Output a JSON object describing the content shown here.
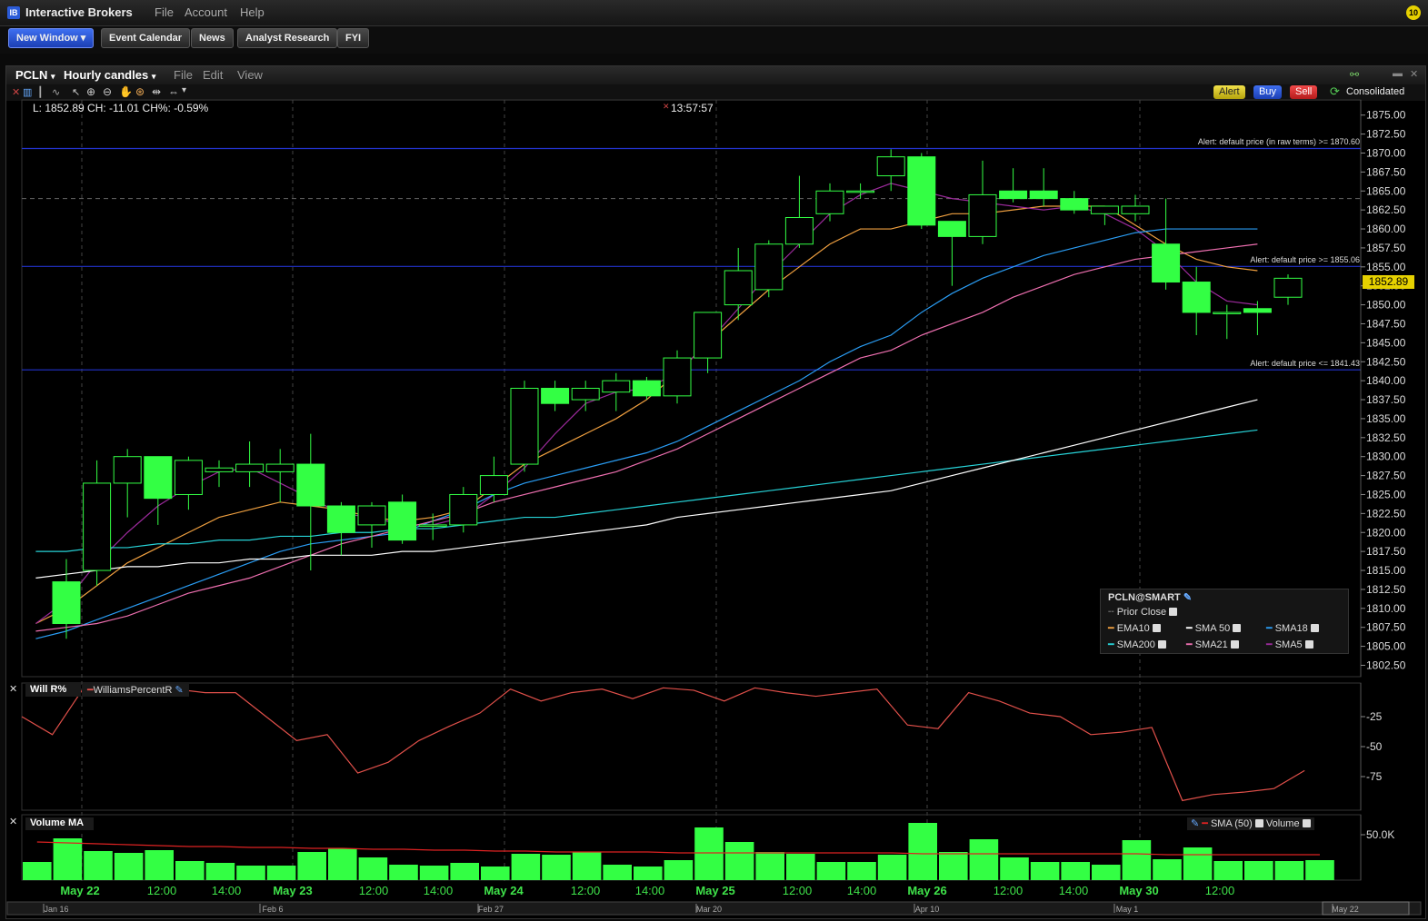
{
  "app": {
    "title": "Interactive Brokers",
    "menu": [
      "File",
      "Account",
      "Help"
    ],
    "badge": "10"
  },
  "toolbar": {
    "new_window": "New Window",
    "buttons": [
      "Event Calendar",
      "News",
      "Analyst Research",
      "FYI"
    ]
  },
  "chart_window": {
    "symbol": "PCLN",
    "interval": "Hourly candles",
    "menu": [
      "File",
      "Edit",
      "View"
    ],
    "actions": {
      "alert": "Alert",
      "buy": "Buy",
      "sell": "Sell",
      "consolidated": "Consolidated"
    },
    "info_line": "L: 1852.89 CH: -11.01 CH%: -0.59%",
    "cursor_time": "13:57:57",
    "last_price": "1852.89"
  },
  "alerts": [
    {
      "text": "Alert: default price (in raw terms) >= 1870.60",
      "price": 1870.6
    },
    {
      "text": "Alert: default price >= 1855.06",
      "price": 1855.06
    },
    {
      "text": "Alert: default price <= 1841.43",
      "price": 1841.43
    }
  ],
  "legend": {
    "title": "PCLN@SMART",
    "items": [
      {
        "name": "Prior Close",
        "color": "#888888"
      },
      {
        "name": "EMA10",
        "color": "#f0a040"
      },
      {
        "name": "SMA 50",
        "color": "#ffffff"
      },
      {
        "name": "SMA18",
        "color": "#2a9df4"
      },
      {
        "name": "SMA200",
        "color": "#27d3d8"
      },
      {
        "name": "SMA21",
        "color": "#ee6fb0"
      },
      {
        "name": "SMA5",
        "color": "#9b2a9b"
      }
    ]
  },
  "will_panel": {
    "title": "Will R%",
    "indicator": "WilliamsPercentR",
    "y_ticks": [
      "-25",
      "-50",
      "-75"
    ]
  },
  "volume_panel": {
    "title": "Volume MA",
    "sma_label": "SMA (50)",
    "volume_label": "Volume",
    "y_tick": "50.0K"
  },
  "x_axis_labels": [
    "May 22",
    "12:00",
    "14:00",
    "May 23",
    "12:00",
    "14:00",
    "May 24",
    "12:00",
    "14:00",
    "May 25",
    "12:00",
    "14:00",
    "May 26",
    "12:00",
    "14:00",
    "May 30",
    "12:00"
  ],
  "nav_labels": [
    "Jan 16",
    "Feb 6",
    "Feb 27",
    "Mar 20",
    "Apr 10",
    "May 1",
    "May 22"
  ],
  "colors": {
    "up": "#33ff44",
    "down": "#33ff44",
    "bg": "#000000",
    "grid": "#444444",
    "alert": "#2233cc",
    "will": "#e0504a",
    "vol_sma": "#dd2222"
  },
  "chart_data": {
    "type": "candlestick",
    "ylim": [
      1801,
      1877
    ],
    "y_ticks": [
      1802.5,
      1805,
      1807.5,
      1810,
      1812.5,
      1815,
      1817.5,
      1820,
      1822.5,
      1825,
      1827.5,
      1830,
      1832.5,
      1835,
      1837.5,
      1840,
      1842.5,
      1845,
      1847.5,
      1850,
      1852.5,
      1855,
      1857.5,
      1860,
      1862.5,
      1865,
      1867.5,
      1870,
      1872.5,
      1875
    ],
    "prior_close": 1864.0,
    "candles": [
      {
        "o": 1813.5,
        "h": 1816.5,
        "l": 1806,
        "c": 1808
      },
      {
        "o": 1815,
        "h": 1829.5,
        "l": 1813,
        "c": 1826.5
      },
      {
        "o": 1826.5,
        "h": 1831,
        "l": 1822,
        "c": 1830
      },
      {
        "o": 1830,
        "h": 1830,
        "l": 1821,
        "c": 1824.5
      },
      {
        "o": 1825,
        "h": 1830,
        "l": 1823,
        "c": 1829.5
      },
      {
        "o": 1828,
        "h": 1829.5,
        "l": 1826,
        "c": 1828.5
      },
      {
        "o": 1828,
        "h": 1832,
        "l": 1826,
        "c": 1829
      },
      {
        "o": 1828,
        "h": 1831,
        "l": 1824,
        "c": 1829
      },
      {
        "o": 1829,
        "h": 1833,
        "l": 1815,
        "c": 1823.5
      },
      {
        "o": 1823.5,
        "h": 1824,
        "l": 1817,
        "c": 1820
      },
      {
        "o": 1821,
        "h": 1824,
        "l": 1818,
        "c": 1823.5
      },
      {
        "o": 1824,
        "h": 1825,
        "l": 1818.5,
        "c": 1819
      },
      {
        "o": 1821,
        "h": 1822.5,
        "l": 1819,
        "c": 1821
      },
      {
        "o": 1821,
        "h": 1826,
        "l": 1820,
        "c": 1825
      },
      {
        "o": 1825,
        "h": 1830,
        "l": 1824,
        "c": 1827.5
      },
      {
        "o": 1829,
        "h": 1840,
        "l": 1828,
        "c": 1839
      },
      {
        "o": 1839,
        "h": 1840,
        "l": 1836,
        "c": 1837
      },
      {
        "o": 1837.5,
        "h": 1840,
        "l": 1836,
        "c": 1839
      },
      {
        "o": 1838.5,
        "h": 1841,
        "l": 1836,
        "c": 1840
      },
      {
        "o": 1840,
        "h": 1840.5,
        "l": 1837.5,
        "c": 1838
      },
      {
        "o": 1838,
        "h": 1844,
        "l": 1837,
        "c": 1843
      },
      {
        "o": 1843,
        "h": 1849,
        "l": 1841,
        "c": 1849
      },
      {
        "o": 1850,
        "h": 1857.5,
        "l": 1848,
        "c": 1854.5
      },
      {
        "o": 1852,
        "h": 1858.5,
        "l": 1851,
        "c": 1858
      },
      {
        "o": 1858,
        "h": 1867,
        "l": 1857.5,
        "c": 1861.5
      },
      {
        "o": 1862,
        "h": 1866,
        "l": 1861,
        "c": 1865
      },
      {
        "o": 1865,
        "h": 1866,
        "l": 1864,
        "c": 1865
      },
      {
        "o": 1867,
        "h": 1870.5,
        "l": 1865,
        "c": 1869.5
      },
      {
        "o": 1869.5,
        "h": 1870,
        "l": 1860,
        "c": 1860.5
      },
      {
        "o": 1861,
        "h": 1861,
        "l": 1852.5,
        "c": 1859
      },
      {
        "o": 1859,
        "h": 1869,
        "l": 1858,
        "c": 1864.5
      },
      {
        "o": 1865,
        "h": 1868,
        "l": 1863.5,
        "c": 1864
      },
      {
        "o": 1865,
        "h": 1868,
        "l": 1863,
        "c": 1864
      },
      {
        "o": 1864,
        "h": 1865,
        "l": 1862,
        "c": 1862.5
      },
      {
        "o": 1862,
        "h": 1863,
        "l": 1860.5,
        "c": 1863
      },
      {
        "o": 1862,
        "h": 1864.5,
        "l": 1861,
        "c": 1863
      },
      {
        "o": 1858,
        "h": 1864,
        "l": 1852,
        "c": 1853
      },
      {
        "o": 1853,
        "h": 1855,
        "l": 1846,
        "c": 1849
      },
      {
        "o": 1849,
        "h": 1850,
        "l": 1845.5,
        "c": 1849
      },
      {
        "o": 1849.5,
        "h": 1850.5,
        "l": 1846,
        "c": 1849
      },
      {
        "o": 1851,
        "h": 1854,
        "l": 1850,
        "c": 1853.5
      }
    ],
    "series": [
      {
        "name": "EMA10",
        "color": "#f0a040",
        "values": [
          1808,
          1810,
          1813,
          1816,
          1818,
          1820,
          1822,
          1823,
          1824,
          1823.5,
          1823,
          1822,
          1821.5,
          1822,
          1823,
          1826,
          1829,
          1831,
          1833,
          1835,
          1837.5,
          1841,
          1845,
          1848.5,
          1852,
          1855,
          1858,
          1860,
          1860,
          1861,
          1862,
          1862,
          1862.5,
          1863,
          1863,
          1863,
          1860.5,
          1858,
          1856,
          1855,
          1854.5
        ]
      },
      {
        "name": "SMA5",
        "color": "#9b2a9b",
        "values": [
          1808,
          1811,
          1816,
          1820,
          1823.5,
          1826,
          1828,
          1828.5,
          1826.5,
          1824.5,
          1822.5,
          1822,
          1821,
          1821,
          1822,
          1825,
          1828.5,
          1833,
          1837,
          1838.5,
          1839,
          1841,
          1845,
          1849.5,
          1854,
          1858,
          1862,
          1864.5,
          1866,
          1865,
          1864,
          1863.5,
          1863,
          1862.5,
          1863,
          1862,
          1860,
          1857,
          1853,
          1850.5,
          1850
        ]
      },
      {
        "name": "SMA18",
        "color": "#2a9df4",
        "values": [
          1806,
          1807,
          1808.5,
          1810,
          1811.5,
          1813,
          1814.5,
          1816,
          1817.5,
          1818.5,
          1819,
          1819.5,
          1820,
          1821.5,
          1823,
          1825,
          1826.5,
          1827.5,
          1828.5,
          1829.5,
          1830.5,
          1832,
          1834,
          1836,
          1838,
          1840,
          1842.5,
          1844.5,
          1846,
          1849,
          1851.5,
          1853.5,
          1855,
          1856.5,
          1857.5,
          1858.5,
          1859.5,
          1860,
          1860,
          1860,
          1860
        ]
      },
      {
        "name": "SMA21",
        "color": "#ee6fb0",
        "values": [
          1807,
          1807.5,
          1808,
          1809,
          1810.5,
          1812,
          1813,
          1814,
          1815.5,
          1817,
          1818.5,
          1819.5,
          1820.5,
          1821.5,
          1822.5,
          1824,
          1825,
          1826,
          1827,
          1828,
          1829.5,
          1831,
          1833,
          1835,
          1837,
          1839,
          1841,
          1843,
          1844,
          1846,
          1847.5,
          1849,
          1851,
          1852.5,
          1854,
          1855,
          1856,
          1856.5,
          1857,
          1857.5,
          1858
        ]
      },
      {
        "name": "SMA200",
        "color": "#27d3d8",
        "values": [
          1817.5,
          1817.5,
          1818,
          1818,
          1818.5,
          1818.5,
          1819,
          1819,
          1819.5,
          1819.5,
          1820,
          1820,
          1820.5,
          1820.5,
          1821,
          1821.5,
          1822,
          1822,
          1822.5,
          1823,
          1823.5,
          1824,
          1824.5,
          1825,
          1825.5,
          1826,
          1826.5,
          1827,
          1827.5,
          1828,
          1828.5,
          1829,
          1829.5,
          1830,
          1830.5,
          1831,
          1831.5,
          1832,
          1832.5,
          1833,
          1833.5
        ]
      },
      {
        "name": "SMA 50",
        "color": "#ffffff",
        "values": [
          1814,
          1814.5,
          1815,
          1815.5,
          1815.5,
          1816,
          1816,
          1816.5,
          1816.5,
          1817,
          1817,
          1817,
          1817.5,
          1817.5,
          1818,
          1818.5,
          1819,
          1819.5,
          1820,
          1820.5,
          1821,
          1822,
          1822.5,
          1823,
          1823.5,
          1824,
          1824.5,
          1825,
          1825.5,
          1826.5,
          1827.5,
          1828.5,
          1829.5,
          1830.5,
          1831.5,
          1832.5,
          1833.5,
          1834.5,
          1835.5,
          1836.5,
          1837.5
        ]
      }
    ],
    "williams_r": [
      -25,
      -40,
      -2,
      -2,
      -5,
      -2,
      -5,
      -5,
      -25,
      -45,
      -40,
      -72,
      -63,
      -45,
      -33,
      -22,
      -2,
      -12,
      -5,
      -2,
      -10,
      -1,
      -3,
      -12,
      -1,
      -5,
      -8,
      -5,
      -2,
      -32,
      -35,
      -5,
      -12,
      -22,
      -25,
      -40,
      -38,
      -34,
      -95,
      -90,
      -88,
      -85,
      -70
    ],
    "volume": [
      20,
      46,
      32,
      30,
      33,
      21,
      19,
      16,
      16,
      31,
      35,
      25,
      17,
      16,
      19,
      15,
      29,
      28,
      31,
      17,
      15,
      22,
      58,
      42,
      31,
      29,
      20,
      20,
      28,
      63,
      31,
      45,
      25,
      20,
      20,
      17,
      44,
      23,
      36,
      21,
      21,
      21,
      22
    ],
    "volume_sma": [
      42,
      41,
      40,
      39,
      38,
      37,
      37,
      36,
      36,
      35,
      35,
      34,
      34,
      33,
      33,
      32,
      32,
      31,
      31,
      31,
      31,
      30,
      30,
      30,
      30,
      30,
      30,
      30,
      30,
      29,
      29,
      29,
      29,
      29,
      29,
      29,
      29,
      28,
      28,
      28,
      28,
      28,
      28
    ]
  }
}
